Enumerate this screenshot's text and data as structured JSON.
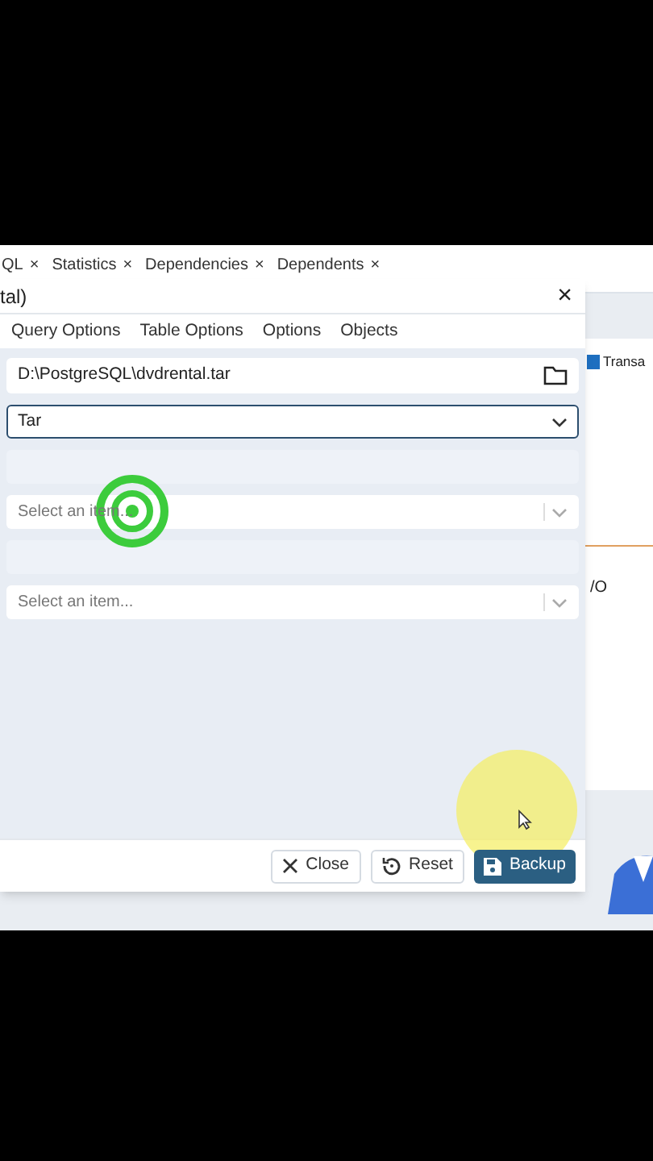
{
  "background_tabs": [
    {
      "label": "QL",
      "close": "×"
    },
    {
      "label": "Statistics",
      "close": "×"
    },
    {
      "label": "Dependencies",
      "close": "×"
    },
    {
      "label": "Dependents",
      "close": "×"
    }
  ],
  "background_panel": {
    "legend": "Transa",
    "label": "/O"
  },
  "dialog": {
    "title": "tal)",
    "close": "×",
    "tabs": [
      {
        "label": "Query Options",
        "selected": false
      },
      {
        "label": "Table Options",
        "selected": false
      },
      {
        "label": "Options",
        "selected": false
      },
      {
        "label": "Objects",
        "selected": false
      }
    ],
    "fields": [
      {
        "kind": "file",
        "value": "D:\\PostgreSQL\\dvdrental.tar"
      },
      {
        "kind": "select",
        "value": "Tar",
        "focused": true
      },
      {
        "kind": "blank"
      },
      {
        "kind": "select",
        "placeholder": "Select an item...",
        "focused": false
      },
      {
        "kind": "blank"
      },
      {
        "kind": "select",
        "placeholder": "Select an item...",
        "focused": false
      }
    ],
    "buttons": [
      {
        "kind": "close",
        "label": "Close"
      },
      {
        "kind": "reset",
        "label": "Reset"
      },
      {
        "kind": "backup",
        "label": "Backup"
      }
    ]
  }
}
